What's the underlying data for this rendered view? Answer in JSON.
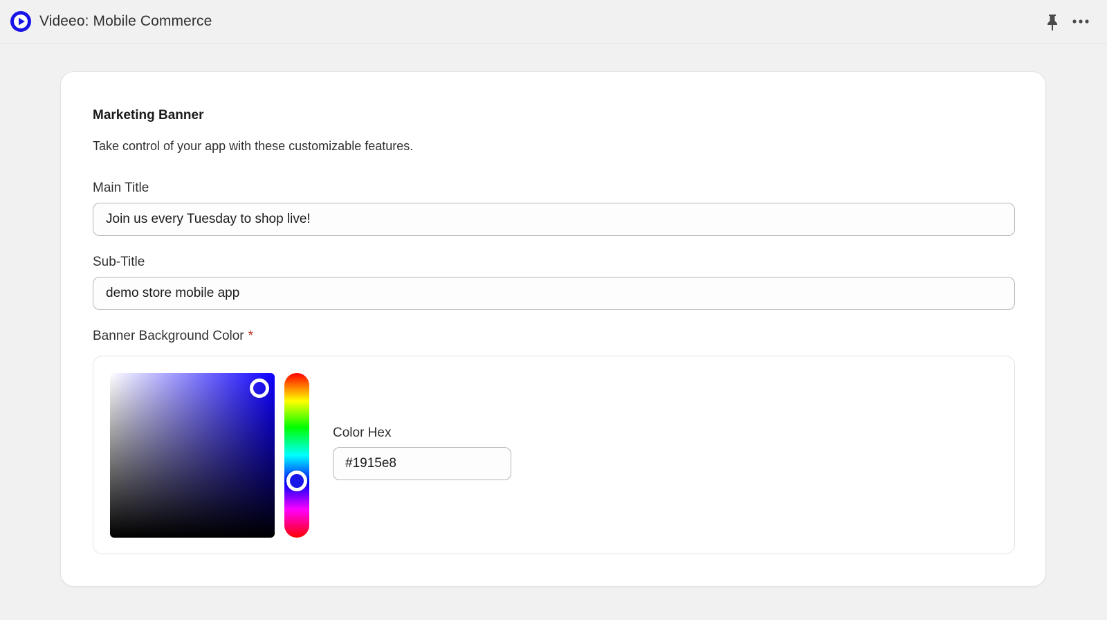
{
  "header": {
    "title": "Videeo: Mobile Commerce",
    "app_icon": "play-circle-icon",
    "accent_color": "#1915e8"
  },
  "card": {
    "title": "Marketing Banner",
    "description": "Take control of your app with these customizable features.",
    "main_title": {
      "label": "Main Title",
      "value": "Join us every Tuesday to shop live!"
    },
    "sub_title": {
      "label": "Sub-Title",
      "value": "demo store mobile app"
    },
    "banner_color": {
      "label": "Banner Background Color",
      "required_marker": "*",
      "hex_label": "Color Hex",
      "hex_value": "#1915e8"
    }
  }
}
